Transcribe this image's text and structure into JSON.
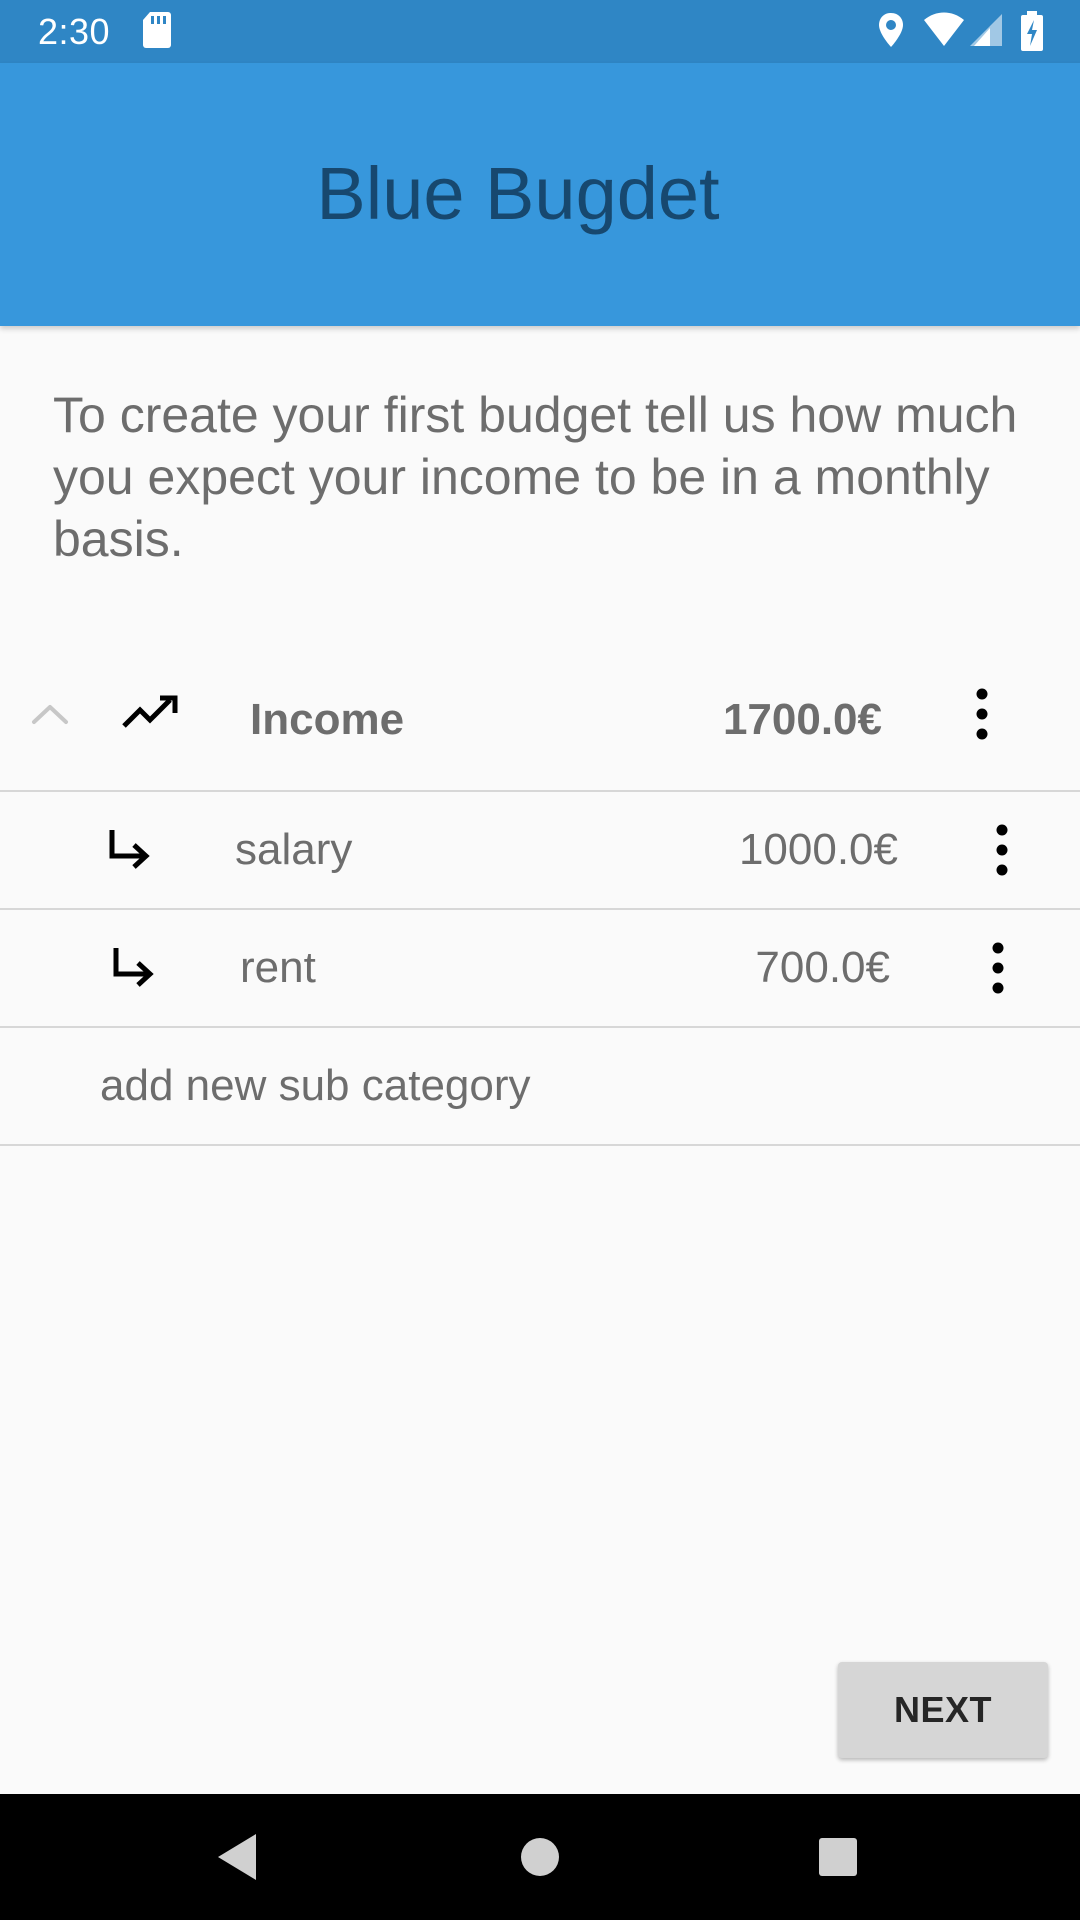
{
  "status_bar": {
    "time": "2:30",
    "icons": [
      "sd-card-icon",
      "location-icon",
      "wifi-icon",
      "signal-icon",
      "battery-charging-icon"
    ]
  },
  "app_bar": {
    "title": "Blue Bugdet"
  },
  "intro": {
    "text": "To create your first budget tell us how much you expect your income to be in a monthly basis."
  },
  "category": {
    "name": "Income",
    "amount": "1700.0€",
    "icon": "trending-up-icon",
    "expanded": true
  },
  "sub_categories": [
    {
      "name": "salary",
      "amount": "1000.0€"
    },
    {
      "name": "rent",
      "amount": "700.0€"
    }
  ],
  "add_sub_category": {
    "label": "add new sub category"
  },
  "actions": {
    "next_label": "NEXT"
  },
  "navigation": {
    "buttons": [
      "back-icon",
      "home-icon",
      "recents-icon"
    ]
  },
  "colors": {
    "status_bar": "#2f86c5",
    "app_bar": "#3797dc",
    "title_text": "#17486f",
    "body_text": "#6d6d6d",
    "background": "#fafafa",
    "button": "#d6d6d6"
  }
}
